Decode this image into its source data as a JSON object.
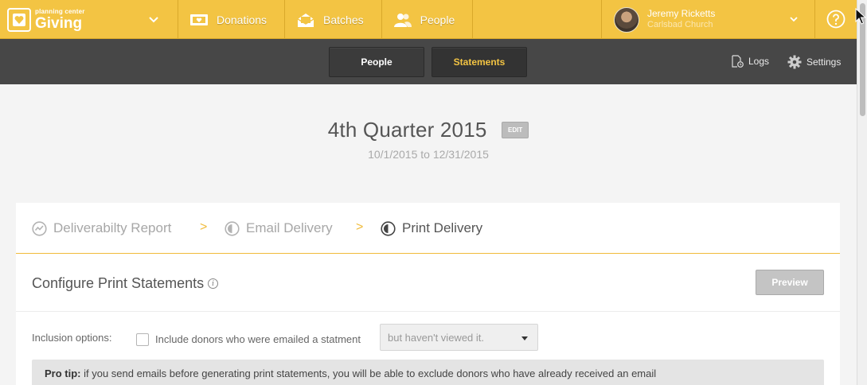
{
  "brand": {
    "small": "planning center",
    "big": "Giving"
  },
  "nav": [
    {
      "label": "Donations",
      "icon": "donations-icon"
    },
    {
      "label": "Batches",
      "icon": "batches-icon"
    },
    {
      "label": "People",
      "icon": "people-icon"
    }
  ],
  "user": {
    "name": "Jeremy Ricketts",
    "org": "Carlsbad Church"
  },
  "subnav": {
    "people": "People",
    "statements": "Statements",
    "logs": "Logs",
    "settings": "Settings"
  },
  "header": {
    "title": "4th Quarter 2015",
    "edit": "EDIT",
    "daterange": "10/1/2015 to 12/31/2015"
  },
  "steps": [
    {
      "label": "Deliverabilty Report",
      "icon": "chart-icon",
      "active": false
    },
    {
      "label": "Email Delivery",
      "icon": "half-circle-icon",
      "active": false
    },
    {
      "label": "Print Delivery",
      "icon": "half-circle-icon",
      "active": true
    }
  ],
  "step_separator": ">",
  "config": {
    "title": "Configure Print Statements",
    "info": "i",
    "preview": "Preview",
    "inclusion_label": "Inclusion options:",
    "inclusion_checkbox_checked": false,
    "inclusion_text": "Include donors who were emailed a statment",
    "select_value": "but haven't viewed it.",
    "protip_label": "Pro tip:",
    "protip_text": " if you send emails before generating print statements, you will be able to exclude donors who have already received an email"
  },
  "colors": {
    "brand_yellow": "#f3c443",
    "subnav_dark": "#474747",
    "accent": "#f0bb3a"
  }
}
